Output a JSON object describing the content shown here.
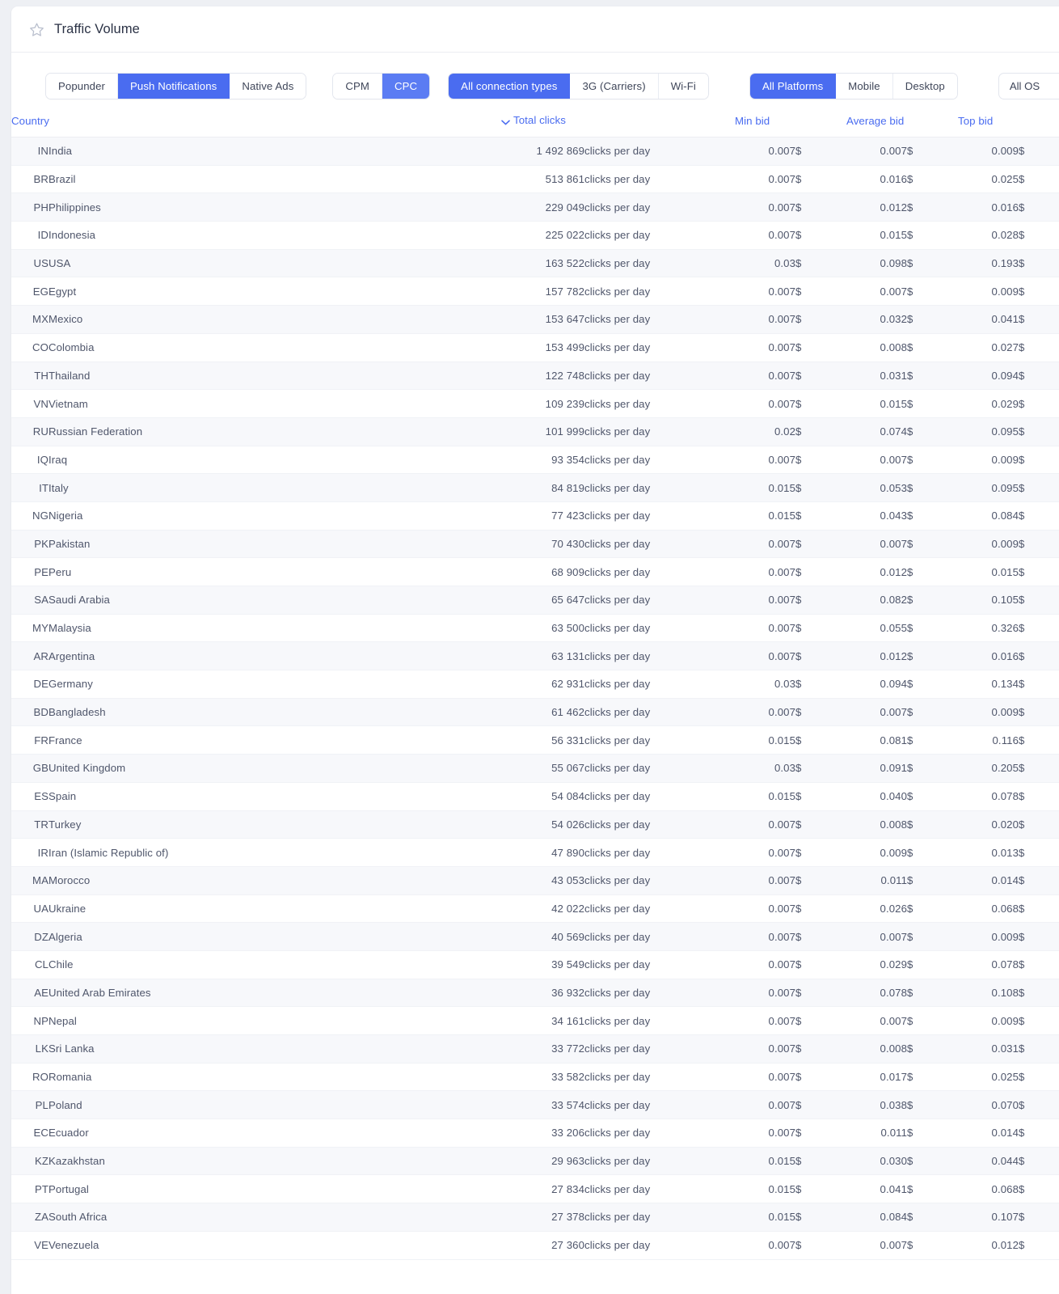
{
  "header": {
    "title": "Traffic Volume",
    "star_icon": "star-icon"
  },
  "filters": {
    "ad_format": {
      "options": [
        "Popunder",
        "Push Notifications",
        "Native Ads"
      ],
      "selected": "Push Notifications"
    },
    "pricing_model": {
      "options": [
        "CPM",
        "CPC"
      ],
      "selected": "CPC"
    },
    "connection": {
      "options": [
        "All connection types",
        "3G (Carriers)",
        "Wi-Fi"
      ],
      "selected": "All connection types"
    },
    "platform": {
      "options": [
        "All Platforms",
        "Mobile",
        "Desktop"
      ],
      "selected": "All Platforms"
    },
    "os": {
      "selected": "All OS",
      "options": [
        "All OS"
      ],
      "chevron_icon": "chevron-down-icon"
    }
  },
  "table": {
    "columns": {
      "country": "Country",
      "total_clicks": "Total clicks",
      "min_bid": "Min bid",
      "average_bid": "Average bid",
      "top_bid": "Top bid"
    },
    "sort": {
      "column": "Total clicks",
      "direction": "desc",
      "icon": "chevron-down-icon"
    },
    "unit_label": "clicks per day",
    "currency_symbol": "$",
    "rows": [
      {
        "code": "IN",
        "name": "India",
        "clicks": "1 492 869",
        "min": "0.007",
        "avg": "0.007",
        "top": "0.009"
      },
      {
        "code": "BR",
        "name": "Brazil",
        "clicks": "513 861",
        "min": "0.007",
        "avg": "0.016",
        "top": "0.025"
      },
      {
        "code": "PH",
        "name": "Philippines",
        "clicks": "229 049",
        "min": "0.007",
        "avg": "0.012",
        "top": "0.016"
      },
      {
        "code": "ID",
        "name": "Indonesia",
        "clicks": "225 022",
        "min": "0.007",
        "avg": "0.015",
        "top": "0.028"
      },
      {
        "code": "US",
        "name": "USA",
        "clicks": "163 522",
        "min": "0.03",
        "avg": "0.098",
        "top": "0.193"
      },
      {
        "code": "EG",
        "name": "Egypt",
        "clicks": "157 782",
        "min": "0.007",
        "avg": "0.007",
        "top": "0.009"
      },
      {
        "code": "MX",
        "name": "Mexico",
        "clicks": "153 647",
        "min": "0.007",
        "avg": "0.032",
        "top": "0.041"
      },
      {
        "code": "CO",
        "name": "Colombia",
        "clicks": "153 499",
        "min": "0.007",
        "avg": "0.008",
        "top": "0.027"
      },
      {
        "code": "TH",
        "name": "Thailand",
        "clicks": "122 748",
        "min": "0.007",
        "avg": "0.031",
        "top": "0.094"
      },
      {
        "code": "VN",
        "name": "Vietnam",
        "clicks": "109 239",
        "min": "0.007",
        "avg": "0.015",
        "top": "0.029"
      },
      {
        "code": "RU",
        "name": "Russian Federation",
        "clicks": "101 999",
        "min": "0.02",
        "avg": "0.074",
        "top": "0.095"
      },
      {
        "code": "IQ",
        "name": "Iraq",
        "clicks": "93 354",
        "min": "0.007",
        "avg": "0.007",
        "top": "0.009"
      },
      {
        "code": "IT",
        "name": "Italy",
        "clicks": "84 819",
        "min": "0.015",
        "avg": "0.053",
        "top": "0.095"
      },
      {
        "code": "NG",
        "name": "Nigeria",
        "clicks": "77 423",
        "min": "0.015",
        "avg": "0.043",
        "top": "0.084"
      },
      {
        "code": "PK",
        "name": "Pakistan",
        "clicks": "70 430",
        "min": "0.007",
        "avg": "0.007",
        "top": "0.009"
      },
      {
        "code": "PE",
        "name": "Peru",
        "clicks": "68 909",
        "min": "0.007",
        "avg": "0.012",
        "top": "0.015"
      },
      {
        "code": "SA",
        "name": "Saudi Arabia",
        "clicks": "65 647",
        "min": "0.007",
        "avg": "0.082",
        "top": "0.105"
      },
      {
        "code": "MY",
        "name": "Malaysia",
        "clicks": "63 500",
        "min": "0.007",
        "avg": "0.055",
        "top": "0.326"
      },
      {
        "code": "AR",
        "name": "Argentina",
        "clicks": "63 131",
        "min": "0.007",
        "avg": "0.012",
        "top": "0.016"
      },
      {
        "code": "DE",
        "name": "Germany",
        "clicks": "62 931",
        "min": "0.03",
        "avg": "0.094",
        "top": "0.134"
      },
      {
        "code": "BD",
        "name": "Bangladesh",
        "clicks": "61 462",
        "min": "0.007",
        "avg": "0.007",
        "top": "0.009"
      },
      {
        "code": "FR",
        "name": "France",
        "clicks": "56 331",
        "min": "0.015",
        "avg": "0.081",
        "top": "0.116"
      },
      {
        "code": "GB",
        "name": "United Kingdom",
        "clicks": "55 067",
        "min": "0.03",
        "avg": "0.091",
        "top": "0.205"
      },
      {
        "code": "ES",
        "name": "Spain",
        "clicks": "54 084",
        "min": "0.015",
        "avg": "0.040",
        "top": "0.078"
      },
      {
        "code": "TR",
        "name": "Turkey",
        "clicks": "54 026",
        "min": "0.007",
        "avg": "0.008",
        "top": "0.020"
      },
      {
        "code": "IR",
        "name": "Iran (Islamic Republic of)",
        "clicks": "47 890",
        "min": "0.007",
        "avg": "0.009",
        "top": "0.013"
      },
      {
        "code": "MA",
        "name": "Morocco",
        "clicks": "43 053",
        "min": "0.007",
        "avg": "0.011",
        "top": "0.014"
      },
      {
        "code": "UA",
        "name": "Ukraine",
        "clicks": "42 022",
        "min": "0.007",
        "avg": "0.026",
        "top": "0.068"
      },
      {
        "code": "DZ",
        "name": "Algeria",
        "clicks": "40 569",
        "min": "0.007",
        "avg": "0.007",
        "top": "0.009"
      },
      {
        "code": "CL",
        "name": "Chile",
        "clicks": "39 549",
        "min": "0.007",
        "avg": "0.029",
        "top": "0.078"
      },
      {
        "code": "AE",
        "name": "United Arab Emirates",
        "clicks": "36 932",
        "min": "0.007",
        "avg": "0.078",
        "top": "0.108"
      },
      {
        "code": "NP",
        "name": "Nepal",
        "clicks": "34 161",
        "min": "0.007",
        "avg": "0.007",
        "top": "0.009"
      },
      {
        "code": "LK",
        "name": "Sri Lanka",
        "clicks": "33 772",
        "min": "0.007",
        "avg": "0.008",
        "top": "0.031"
      },
      {
        "code": "RO",
        "name": "Romania",
        "clicks": "33 582",
        "min": "0.007",
        "avg": "0.017",
        "top": "0.025"
      },
      {
        "code": "PL",
        "name": "Poland",
        "clicks": "33 574",
        "min": "0.007",
        "avg": "0.038",
        "top": "0.070"
      },
      {
        "code": "EC",
        "name": "Ecuador",
        "clicks": "33 206",
        "min": "0.007",
        "avg": "0.011",
        "top": "0.014"
      },
      {
        "code": "KZ",
        "name": "Kazakhstan",
        "clicks": "29 963",
        "min": "0.015",
        "avg": "0.030",
        "top": "0.044"
      },
      {
        "code": "PT",
        "name": "Portugal",
        "clicks": "27 834",
        "min": "0.015",
        "avg": "0.041",
        "top": "0.068"
      },
      {
        "code": "ZA",
        "name": "South Africa",
        "clicks": "27 378",
        "min": "0.015",
        "avg": "0.084",
        "top": "0.107"
      },
      {
        "code": "VE",
        "name": "Venezuela",
        "clicks": "27 360",
        "min": "0.007",
        "avg": "0.007",
        "top": "0.012"
      }
    ]
  },
  "colors": {
    "accent": "#4a6cf0",
    "accent_light": "#5b7cf3",
    "page_bg": "#eef0f4",
    "row_stripe": "#f7f8fb"
  }
}
